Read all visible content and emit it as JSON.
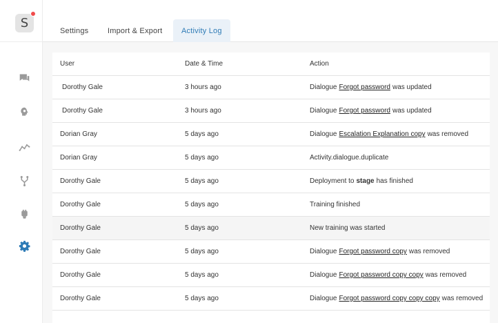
{
  "app": {
    "logo_letter": "S"
  },
  "sidebar": {
    "icons": [
      {
        "name": "chat-icon",
        "color": "#9a9a9a"
      },
      {
        "name": "brain-icon",
        "color": "#9a9a9a"
      },
      {
        "name": "analytics-icon",
        "color": "#9a9a9a"
      },
      {
        "name": "integrations-icon",
        "color": "#9a9a9a"
      },
      {
        "name": "plugin-icon",
        "color": "#9a9a9a"
      },
      {
        "name": "gear-icon",
        "color": "#2e7bb6"
      }
    ]
  },
  "tabs": [
    {
      "label": "Settings",
      "active": false
    },
    {
      "label": "Import & Export",
      "active": false
    },
    {
      "label": "Activity Log",
      "active": true
    }
  ],
  "table": {
    "headers": {
      "user": "User",
      "date": "Date & Time",
      "action": "Action"
    },
    "rows": [
      {
        "user": "Dorothy Gale",
        "date": "3 hours ago",
        "pre": "Dialogue",
        "target": "Forgot password",
        "post": "was updated"
      },
      {
        "user": "Dorothy Gale",
        "date": "3 hours ago",
        "pre": "Dialogue",
        "target": "Forgot password",
        "post": "was updated"
      },
      {
        "user": "Dorian Gray",
        "date": "5 days ago",
        "pre": "Dialogue",
        "target": "Escalation Explanation copy",
        "post": "was removed"
      },
      {
        "user": "Dorian Gray",
        "date": "5 days ago",
        "text": "Activity.dialogue.duplicate"
      },
      {
        "user": "Dorothy Gale",
        "date": "5 days ago",
        "pre": "Deployment to",
        "strong": "stage",
        "post": "has finished"
      },
      {
        "user": "Dorothy Gale",
        "date": "5 days ago",
        "text": "Training finished"
      },
      {
        "user": "Dorothy Gale",
        "date": "5 days ago",
        "text": "New training was started"
      },
      {
        "user": "Dorothy Gale",
        "date": "5 days ago",
        "pre": "Dialogue",
        "target": "Forgot password copy",
        "post": "was removed"
      },
      {
        "user": "Dorothy Gale",
        "date": "5 days ago",
        "pre": "Dialogue",
        "target": "Forgot password copy copy",
        "post": "was removed"
      },
      {
        "user": "Dorothy Gale",
        "date": "5 days ago",
        "pre": "Dialogue",
        "target": "Forgot password copy copy copy",
        "post": "was removed"
      }
    ]
  }
}
